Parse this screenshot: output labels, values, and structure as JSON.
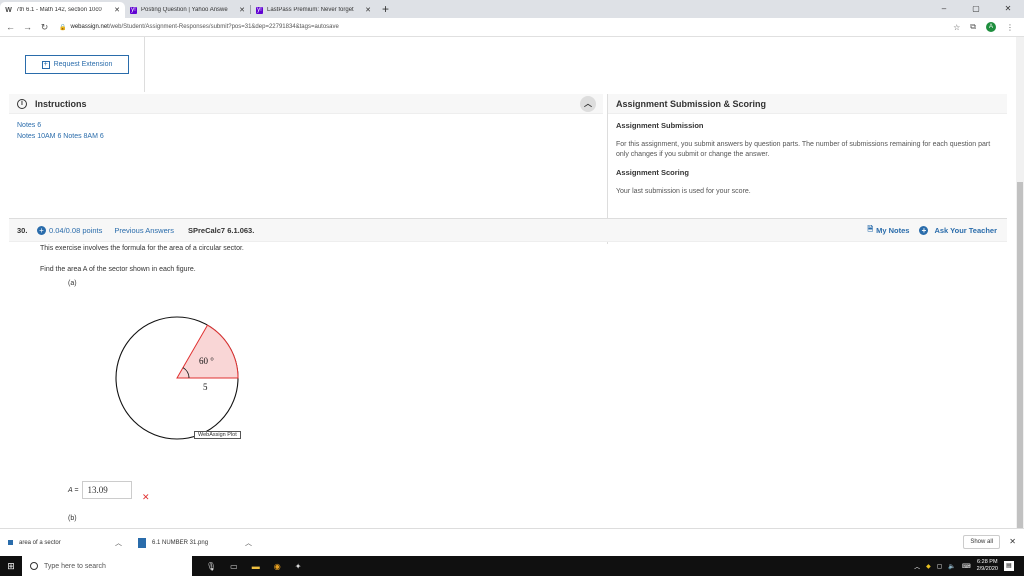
{
  "browser": {
    "tabs": [
      {
        "label": "7th 6.1 - Math 142, section 10c0",
        "icon": "webassign-icon",
        "active": true
      },
      {
        "label": "Posting Question | Yahoo Answe",
        "icon": "yahoo-icon",
        "active": false
      },
      {
        "label": "LastPass Premium: Never forget",
        "icon": "yahoo-icon",
        "active": false
      }
    ],
    "new_tab": "+",
    "window_controls": [
      "–",
      "▢",
      "✕"
    ],
    "url_host": "webassign.net",
    "url_path": "/web/Student/Assignment-Responses/submit?pos=31&dep=22791834&tags=autosave",
    "avatar_letter": "A"
  },
  "request_extension": {
    "label": "Request Extension"
  },
  "instructions": {
    "title": "Instructions",
    "links": [
      "Notes 6",
      "Notes 10AM 6 Notes 8AM 6"
    ]
  },
  "scoring": {
    "title": "Assignment Submission & Scoring",
    "submission_heading": "Assignment Submission",
    "submission_text": "For this assignment, you submit answers by question parts. The number of submissions remaining for each question part only changes if you submit or change the answer.",
    "scoring_heading": "Assignment Scoring",
    "scoring_text": "Your last submission is used for your score."
  },
  "question": {
    "number": "30.",
    "points": "0.04/0.08 points",
    "previous_answers": "Previous Answers",
    "source": "SPreCalc7 6.1.063.",
    "my_notes": "My Notes",
    "ask_teacher": "Ask Your Teacher",
    "intro": "This exercise involves the formula for the area of a circular sector.",
    "prompt": "Find the area A of the sector shown in each figure.",
    "part_a": "(a)",
    "part_b": "(b)",
    "figure": {
      "angle_label": "60 °",
      "radius_label": "5",
      "angle_deg": 60,
      "plot_label": "WebAssign Plot"
    },
    "answer_label": "A =",
    "answer_value": "13.09",
    "answer_status": "✕"
  },
  "downloads": {
    "items": [
      "area of a sector",
      "6.1 NUMBER 31.png"
    ],
    "show_all": "Show all"
  },
  "taskbar": {
    "search_placeholder": "Type here to search",
    "time": "6:28 PM",
    "date": "2/9/2020"
  }
}
